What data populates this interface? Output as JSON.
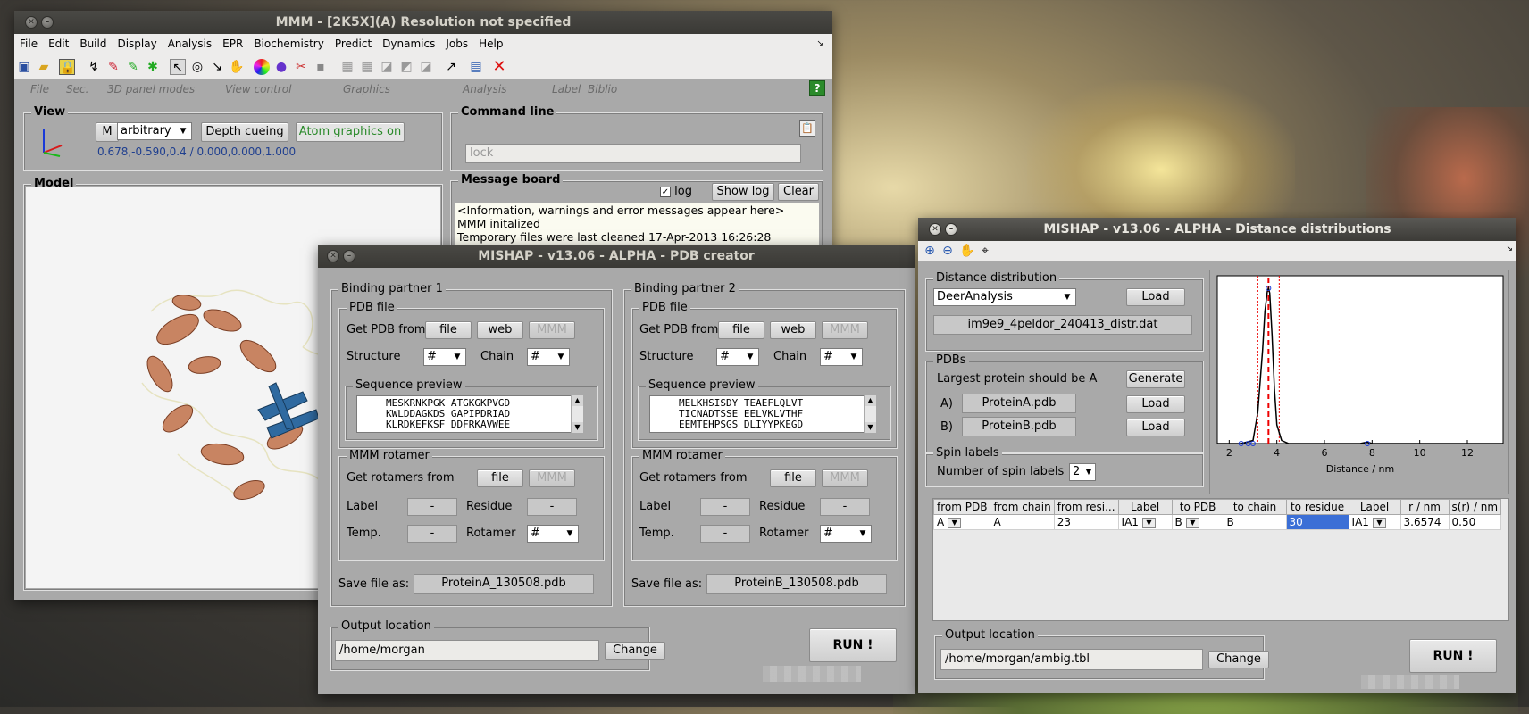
{
  "mmm": {
    "title": "MMM - [2K5X](A) Resolution not specified",
    "menu": [
      "File",
      "Edit",
      "Build",
      "Display",
      "Analysis",
      "EPR",
      "Biochemistry",
      "Predict",
      "Dynamics",
      "Jobs",
      "Help"
    ],
    "panel_modes": [
      "File",
      "Sec.",
      "3D panel modes",
      "View control",
      "Graphics",
      "Analysis",
      "Label",
      "Biblio"
    ],
    "view": {
      "title": "View",
      "m_button": "M",
      "mode": "arbitrary",
      "depth_cueing": "Depth cueing",
      "atom_graphics": "Atom graphics on",
      "coords": "0.678,-0.590,0.4",
      "coords_sep": "/",
      "coords2": "0.000,0.000,1.000"
    },
    "command_line": {
      "title": "Command line",
      "value": "lock"
    },
    "model": {
      "title": "Model"
    },
    "message_board": {
      "title": "Message board",
      "log_label": "log",
      "show_log": "Show log",
      "clear": "Clear",
      "lines": [
        "<Information, warnings and error messages appear here>",
        "MMM initalized",
        "Temporary files were last cleaned 17-Apr-2013 16:26:28"
      ]
    }
  },
  "pdb_creator": {
    "title": "MISHAP - v13.06 - ALPHA - PDB creator",
    "partners": [
      {
        "title": "Binding partner 1",
        "pdb_file": "PDB file",
        "get_pdb_from": "Get PDB from",
        "file": "file",
        "web": "web",
        "mmm": "MMM",
        "structure": "Structure",
        "structure_val": "#",
        "chain": "Chain",
        "chain_val": "#",
        "sequence_preview": "Sequence preview",
        "sequence": "MESKRNKPGK ATGKGKPVGD\nKWLDDAGKDS GAPIPDRIAD\nKLRDKEFKSF DDFRKAVWEE",
        "rotamer_title": "MMM rotamer",
        "get_rotamers_from": "Get rotamers from",
        "label": "Label",
        "label_val": "-",
        "residue": "Residue",
        "residue_val": "-",
        "temp": "Temp.",
        "temp_val": "-",
        "rotamer": "Rotamer",
        "rotamer_val": "#",
        "save_as": "Save file as:",
        "filename": "ProteinA_130508.pdb"
      },
      {
        "title": "Binding partner 2",
        "pdb_file": "PDB file",
        "get_pdb_from": "Get PDB from",
        "file": "file",
        "web": "web",
        "mmm": "MMM",
        "structure": "Structure",
        "structure_val": "#",
        "chain": "Chain",
        "chain_val": "#",
        "sequence_preview": "Sequence preview",
        "sequence": "MELKHSISDY TEAEFLQLVT\nTICNADTSSE EELVKLVTHF\nEEMTEHPSGS DLIYYPKEGD",
        "rotamer_title": "MMM rotamer",
        "get_rotamers_from": "Get rotamers from",
        "label": "Label",
        "label_val": "-",
        "residue": "Residue",
        "residue_val": "-",
        "temp": "Temp.",
        "temp_val": "-",
        "rotamer": "Rotamer",
        "rotamer_val": "#",
        "save_as": "Save file as:",
        "filename": "ProteinB_130508.pdb"
      }
    ],
    "output": {
      "title": "Output location",
      "path": "/home/morgan",
      "change": "Change"
    },
    "run": "RUN !"
  },
  "distance": {
    "title": "MISHAP - v13.06 - ALPHA - Distance distributions",
    "dist_title": "Distance distribution",
    "source": "DeerAnalysis",
    "load": "Load",
    "filename": "im9e9_4peldor_240413_distr.dat",
    "pdbs_title": "PDBs",
    "largest": "Largest protein should be A",
    "generate": "Generate",
    "a_label": "A)",
    "a_file": "ProteinA.pdb",
    "b_label": "B)",
    "b_file": "ProteinB.pdb",
    "spin_title": "Spin labels",
    "num_spin": "Number of spin labels",
    "num_spin_val": "2",
    "table": {
      "headers": [
        "from PDB",
        "from chain",
        "from resi...",
        "Label",
        "to PDB",
        "to chain",
        "to residue",
        "Label",
        "r / nm",
        "s(r) / nm"
      ],
      "rows": [
        [
          "A",
          "A",
          "23",
          "IA1",
          "B",
          "B",
          "30",
          "IA1",
          "3.6574",
          "0.50"
        ]
      ]
    },
    "output": {
      "title": "Output location",
      "path": "/home/morgan/ambig.tbl",
      "change": "Change"
    },
    "run": "RUN !"
  },
  "chart_data": {
    "type": "line",
    "xlabel": "Distance / nm",
    "ylabel": "",
    "xlim": [
      1.5,
      13.5
    ],
    "xticks": [
      "2",
      "4",
      "6",
      "8",
      "10",
      "12"
    ],
    "series": [
      {
        "x": [
          1.5,
          2.5,
          3.0,
          3.2,
          3.4,
          3.5,
          3.6,
          3.65,
          3.7,
          3.8,
          3.9,
          4.0,
          4.2,
          4.5,
          6.0,
          7.5,
          7.8,
          8.0,
          13.5
        ],
        "y": [
          0,
          0,
          0.02,
          0.2,
          0.6,
          0.85,
          0.98,
          1.0,
          0.97,
          0.7,
          0.35,
          0.12,
          0.02,
          0,
          0,
          0,
          0.01,
          0,
          0
        ]
      }
    ],
    "markers": [
      2.5,
      2.8,
      3.0,
      3.65,
      7.8
    ],
    "mean_line": 3.65,
    "bounds": [
      3.2,
      4.1
    ]
  }
}
